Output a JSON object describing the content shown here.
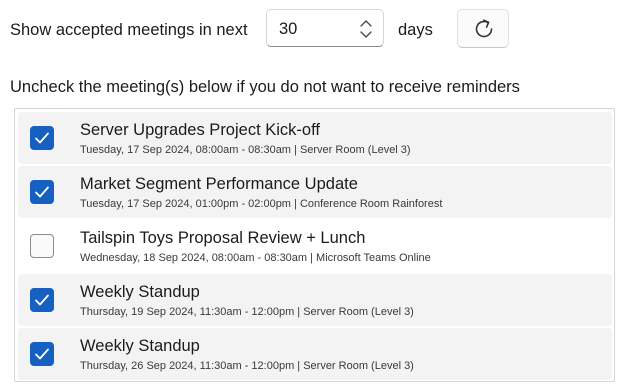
{
  "header": {
    "show_label": "Show accepted meetings in next",
    "days_value": "30",
    "days_label": "days",
    "refresh_icon": "refresh-icon"
  },
  "instructions": "Uncheck the meeting(s) below if you do not want to receive reminders",
  "meetings": [
    {
      "title": "Server Upgrades Project Kick-off",
      "details": "Tuesday, 17 Sep 2024, 08:00am - 08:30am | Server Room (Level 3)",
      "checked": true
    },
    {
      "title": "Market Segment Performance Update",
      "details": "Tuesday, 17 Sep 2024, 01:00pm - 02:00pm | Conference Room Rainforest",
      "checked": true
    },
    {
      "title": "Tailspin Toys Proposal Review + Lunch",
      "details": "Wednesday, 18 Sep 2024, 08:00am - 08:30am | Microsoft Teams Online",
      "checked": false
    },
    {
      "title": "Weekly Standup",
      "details": "Thursday, 19 Sep 2024, 11:30am - 12:00pm | Server Room (Level 3)",
      "checked": true
    },
    {
      "title": "Weekly Standup",
      "details": "Thursday, 26 Sep 2024, 11:30am - 12:00pm | Server Room (Level 3)",
      "checked": true
    }
  ],
  "colors": {
    "accent": "#1560c0",
    "item_background": "#f3f3f3"
  }
}
